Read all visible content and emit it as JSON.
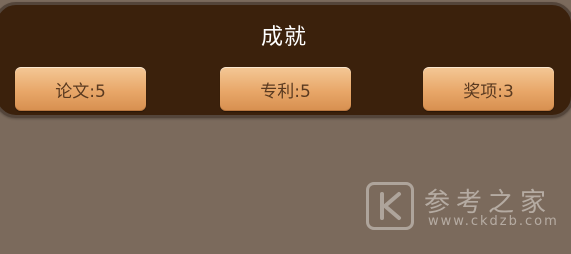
{
  "achievements": {
    "title": "成就",
    "papers_label": "论文:5",
    "patents_label": "专利:5",
    "awards_label": "奖项:3"
  },
  "watermark": {
    "site_name": "参考之家",
    "url": "www.ckdzb.com",
    "icon": "k-logo-icon"
  },
  "colors": {
    "background": "#7b6a5c",
    "panel": "#3b210c",
    "button": "#e8a769",
    "button_text": "#5a3a20"
  }
}
